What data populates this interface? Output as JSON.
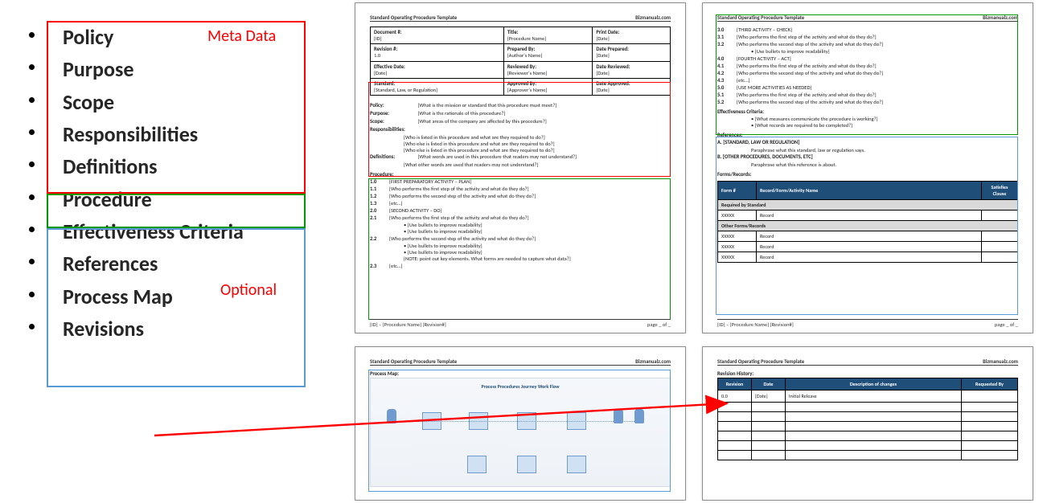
{
  "legend": {
    "items": [
      "Policy",
      "Purpose",
      "Scope",
      "Responsibilities",
      "Definitions",
      "Procedure",
      "Effectiveness Criteria",
      "References",
      "Process Map",
      "Revisions"
    ],
    "badge_meta": "Meta Data",
    "badge_optional": "Optional"
  },
  "document_header": {
    "left": "Standard Operating Procedure Template",
    "right": "Bizmanualz.com"
  },
  "document_footer": {
    "left": "[ID] – [Procedure Name] [Revision#]",
    "right": "page _ of _"
  },
  "page1": {
    "meta": [
      {
        "l1": "Document #:",
        "v1": "[ID]",
        "l2": "Title:",
        "v2": "[Procedure Name]",
        "l3": "Print Date:",
        "v3": "[Date]"
      },
      {
        "l1": "Revision #:",
        "v1": "1.0",
        "l2": "Prepared By:",
        "v2": "[Author's Name]",
        "l3": "Date Prepared:",
        "v3": "[Date]"
      },
      {
        "l1": "Effective Date:",
        "v1": "[Date]",
        "l2": "Reviewed By:",
        "v2": "[Reviewer's Name]",
        "l3": "Date Reviewed:",
        "v3": "[Date]"
      },
      {
        "l1": "Standard:",
        "v1": "[Standard, Law, or Regulation]",
        "l2": "Approved By:",
        "v2": "[Approver's Name]",
        "l3": "Date Approved:",
        "v3": "[Date]"
      }
    ],
    "policy": "[What is the mission or standard that this procedure must meet?]",
    "purpose": "[What is the rationale of this procedure?]",
    "scope": "[What areas of the company are affected by this procedure?]",
    "resp1": "[Who is listed in this procedure and what are they required to do?]",
    "resp2": "[Who else is listed in this procedure and what are they required to do?]",
    "resp3": "[Who else is listed in this procedure and what are they required to do?]",
    "def1": "[What words are used in this procedure that readers may not understand?]",
    "def2": "[What other words are used that readers may not understand?]",
    "proc_title": "Procedure:",
    "p1_0": "[FIRST PREPARATORY ACTIVITY – PLAN]",
    "p1_1": "[Who performs the first step of the activity and what do they do?]",
    "p1_2": "[Who performs the second step of the activity and what do they do?]",
    "p1_3": "[etc…]",
    "p2_0": "[SECOND ACTIVITY – DO]",
    "p2_1": "[Who performs the first step of the activity and what do they do?]",
    "p2_1a": "[Use bullets to improve readability]",
    "p2_1b": "[Use bullets to improve readability]",
    "p2_2": "[Who performs the second step of the activity and what do they do?]",
    "p2_2a": "[Use bullets to improve readability]",
    "p2_2b": "[Use bullets to improve readability]",
    "p2_note": "[NOTE: point out key elements. What forms are needed to capture what data?]",
    "p2_3": "[etc…]"
  },
  "page2": {
    "p3_0": "[THIRD ACTIVITY – CHECK]",
    "p3_1": "[Who performs the first step of the activity and what do they do?]",
    "p3_2": "[Who performs the second step of the activity and what do they do?]",
    "p3_2a": "[Use bullets to improve readability]",
    "p4_0": "[FOURTH ACTIVITY – ACT]",
    "p4_1": "[Who performs the first step of the activity and what do they do?]",
    "p4_2": "[Who performs the second step of the activity and what do they do?]",
    "p4_3": "[etc…]",
    "p5_0": "[USE MORE ACTIVITIES AS NEEDED]",
    "p5_1": "[Who performs the first step of the activity and what do they do?]",
    "p5_2": "[Who performs the second step of the activity and what do they do?]",
    "eff_title": "Effectiveness Criteria:",
    "eff_b1": "[What measures communicate the procedure is working?]",
    "eff_b2": "[What records are required to be completed?]",
    "ref_title": "References:",
    "ref_a": "A. [STANDARD, LAW OR REGULATION]",
    "ref_a_txt": "Paraphrase what this standard, law or regulation says.",
    "ref_b": "B. [OTHER PROCEDURES, DOCUMENTS, ETC]",
    "ref_b_txt": "Paraphrase what this reference is about.",
    "forms_title": "Forms/Records:",
    "forms_headers": [
      "Form #",
      "Record/Form/Activity Name",
      "Satisfies Clause"
    ],
    "forms_section1": "Required by Standard",
    "forms_section2": "Other Forms/Records",
    "form_id": "XXXXX",
    "form_rec": "Record"
  },
  "page3": {
    "title": "Process Map:",
    "map_title": "Process Procedures Journey Work Flow"
  },
  "page4": {
    "title": "Revision History:",
    "headers": [
      "Revision",
      "Date",
      "Description of changes",
      "Requested By"
    ],
    "row0_rev": "0.0",
    "row0_date": "[Date]",
    "row0_desc": "Initial Release"
  },
  "labels": {
    "policy": "Policy:",
    "purpose": "Purpose:",
    "scope": "Scope:",
    "responsibilities": "Responsibilities:",
    "definitions": "Definitions:"
  }
}
